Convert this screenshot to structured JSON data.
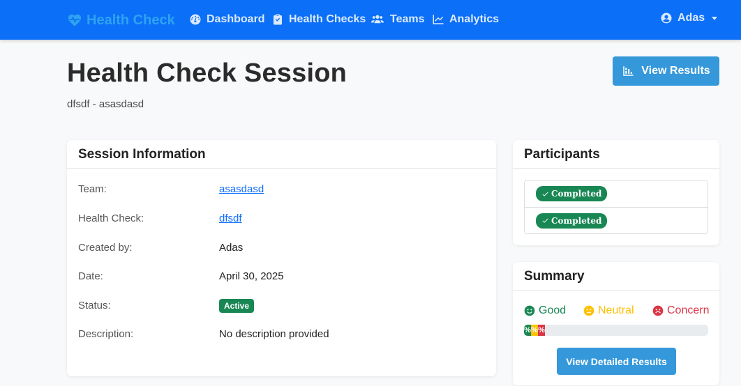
{
  "nav": {
    "brand": "Health Check",
    "items": [
      {
        "label": "Dashboard",
        "icon": "dashboard-icon"
      },
      {
        "label": "Health Checks",
        "icon": "clipboard-icon"
      },
      {
        "label": "Teams",
        "icon": "users-icon"
      },
      {
        "label": "Analytics",
        "icon": "chart-line-icon"
      }
    ],
    "user": "Adas"
  },
  "header": {
    "title": "Health Check Session",
    "subtitle": "dfsdf - asasdasd",
    "view_results_label": "View Results"
  },
  "session_info": {
    "title": "Session Information",
    "rows": [
      {
        "label": "Team:",
        "value": "asasdasd"
      },
      {
        "label": "Health Check:",
        "value": "dfsdf"
      },
      {
        "label": "Created by:",
        "value": "Adas"
      },
      {
        "label": "Date:",
        "value": "April 30, 2025"
      },
      {
        "label": "Status:",
        "value": "Active"
      },
      {
        "label": "Description:",
        "value": "No description provided"
      }
    ]
  },
  "participants": {
    "title": "Participants",
    "items": [
      {
        "status": "Completed"
      },
      {
        "status": "Completed"
      }
    ]
  },
  "summary": {
    "title": "Summary",
    "legend": [
      {
        "label": "Good",
        "color": "#198754",
        "icon": "smile-icon"
      },
      {
        "label": "Neutral",
        "color": "#ffc107",
        "icon": "meh-icon"
      },
      {
        "label": "Concern",
        "color": "#dc3545",
        "icon": "frown-icon"
      }
    ],
    "progress": [
      {
        "label": "%",
        "color": "#198754"
      },
      {
        "label": "%",
        "color": "#ffc107"
      },
      {
        "label": "%",
        "color": "#dc3545"
      }
    ],
    "detail_button_label": "View Detailed Results"
  },
  "colors": {
    "navbar": "#0b6ff7",
    "brand": "#2ea3f2",
    "primary_button": "#3498db",
    "success": "#198754",
    "link": "#0d6efd"
  }
}
